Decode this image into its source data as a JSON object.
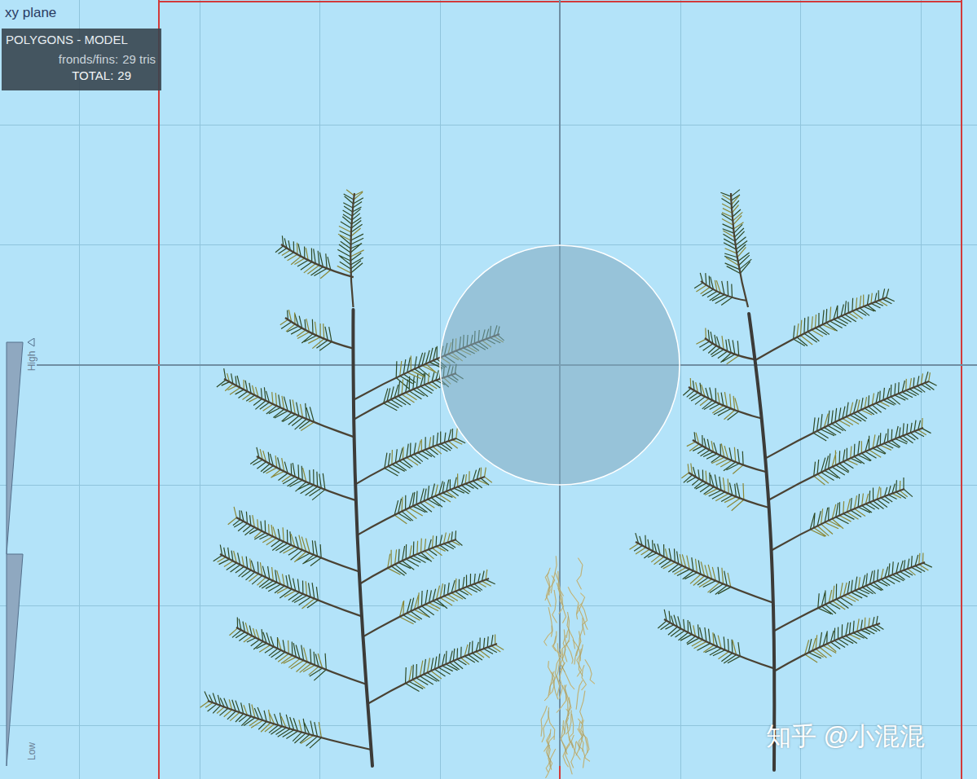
{
  "viewport": {
    "title": "xy plane"
  },
  "stats": {
    "heading": "POLYGONS - MODEL",
    "rows": [
      {
        "label": "fronds/fins:",
        "value": "29 tris"
      },
      {
        "label": "TOTAL:",
        "value": "29"
      }
    ]
  },
  "lod_slider": {
    "high_label": "High",
    "low_label": "Low"
  },
  "watermark": "知乎 @小混混"
}
